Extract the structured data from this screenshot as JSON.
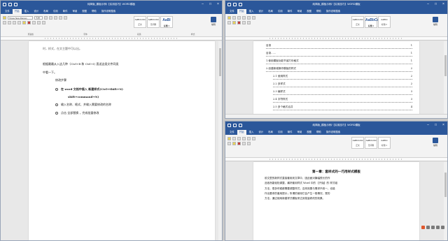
{
  "windows": {
    "left": {
      "title": "纯简版_模板示例/【实用技巧】WORD模板",
      "tabs": [
        "文件",
        "开始",
        "插入",
        "设计",
        "布局",
        "引用",
        "邮件",
        "审阅",
        "视图",
        "帮助",
        "操作说明搜索"
      ],
      "active_tab": "开始",
      "font": "Times New Roman",
      "size": "五号",
      "styles": [
        {
          "preview": "AaBbCcDd",
          "name": "正文"
        },
        {
          "preview": "AaBbCcDd",
          "name": "无间隔"
        },
        {
          "preview": "AaBl",
          "name": "标题 1"
        }
      ],
      "edit_label": "编辑",
      "groups": [
        "剪贴板",
        "字体",
        "段落",
        "样式"
      ],
      "lines": [
        "时，样式，在文主题中可以出。",
        "根据最最从入这几种（Ctrl+B 和 Ctrl+I) 直送这类文件同类",
        "中看一下。",
        "修改步骤",
        "在 word 文档中插入 新建样式(Ctrl+Shift+N)",
        "shift+command+N)",
        "输入名称、格式、并输入需要修改的名称",
        "点击 全部替换 ，完成批量修改"
      ]
    },
    "top_right": {
      "title": "纯简版_模板示例/【实用技巧】WORD模板",
      "tabs": [
        "文件",
        "开始",
        "插入",
        "设计",
        "布局",
        "引用",
        "邮件",
        "审阅",
        "视图",
        "帮助",
        "操作说明搜索"
      ],
      "active_tab": "开始",
      "styles": [
        {
          "preview": "AaBbCcDd",
          "name": "正文"
        },
        {
          "preview": "AaBbCc",
          "name": "标题 1"
        },
        {
          "preview": "AaBbC",
          "name": "标题 2"
        }
      ],
      "edit_label": "编辑",
      "toc": [
        {
          "text": "目录",
          "page": "1"
        },
        {
          "text": "目录……",
          "page": "1"
        },
        {
          "text": "1.使用模板功能节省打印格式",
          "page": "1"
        },
        {
          "text": "2.创建新增操作模板的样式",
          "page": "2"
        },
        {
          "text": "2.1 使用样式",
          "page": "2"
        },
        {
          "text": "2.2 多样式",
          "page": "2"
        },
        {
          "text": "2.3 编样式",
          "page": "3"
        },
        {
          "text": "2.4 字符样式",
          "page": "3"
        },
        {
          "text": "2.5 多个格式合并",
          "page": "4"
        }
      ]
    },
    "bottom_right": {
      "title": "纯简版_模板示例/【实用技巧】WORD模板",
      "tabs": [
        "文件",
        "开始",
        "插入",
        "设计",
        "布局",
        "引用",
        "邮件",
        "审阅",
        "视图",
        "帮助",
        "操作说明搜索"
      ],
      "active_tab": "开始",
      "styles": [
        {
          "preview": "AaBbCcDd",
          "name": "正文"
        },
        {
          "preview": "AaBbCcDd",
          "name": "无间隔"
        },
        {
          "preview": "AaBbC",
          "name": "标题 1"
        }
      ],
      "edit_label": "编辑",
      "heading": "第一章：套样式的一巧用样式模板",
      "para_lines": [
        "前文里的新样式直接套用到文章中，因此面对篇幅很长的作",
        "品依然能轻松调整，最好套用样式 Word 中的 【开始】的 样式组",
        "方法，很多时候都需要调整样式，否则效果与需求不统一，也能",
        "作出要求的套用提示；所谓的使用它会产生一般情况，是的",
        "方法，通过使用新建样式模板来达到批量修改的效果。"
      ]
    }
  }
}
